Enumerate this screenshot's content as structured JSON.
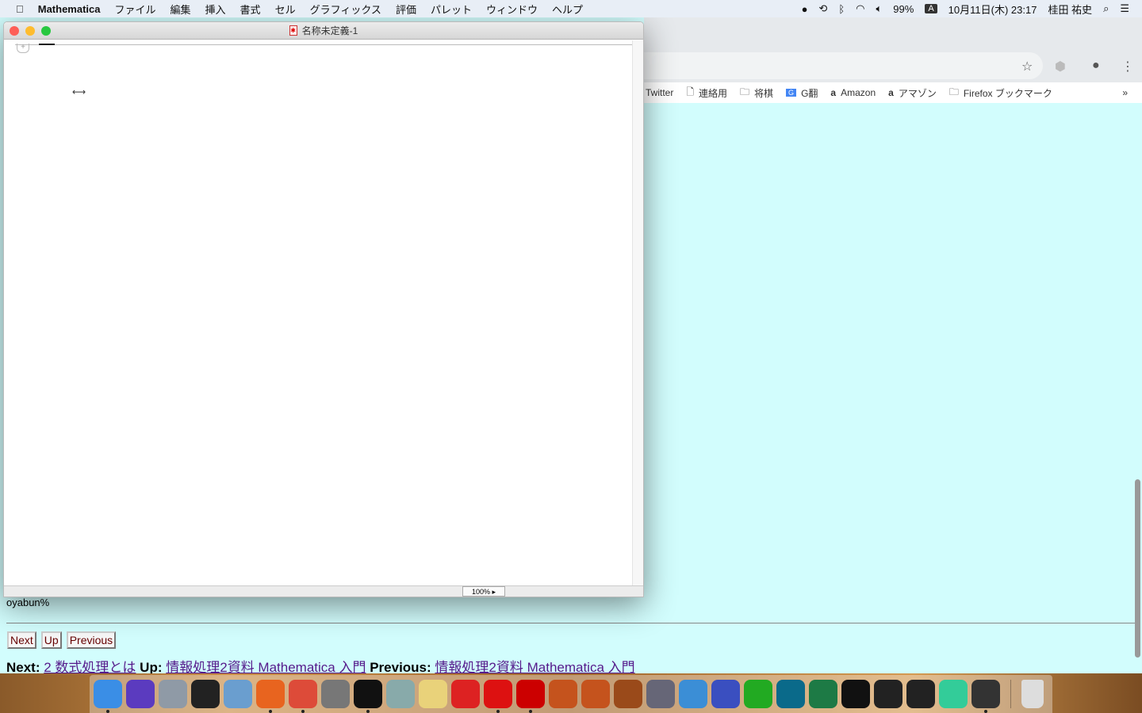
{
  "menubar": {
    "app": "Mathematica",
    "items": [
      "ファイル",
      "編集",
      "挿入",
      "書式",
      "セル",
      "グラフィックス",
      "評価",
      "パレット",
      "ウィンドウ",
      "ヘルプ"
    ],
    "battery": "99%",
    "ime": "A",
    "datetime": "10月11日(木)  23:17",
    "user": "桂田 祐史"
  },
  "window": {
    "title": "名称未定義-1",
    "zoom": "100%",
    "colors": {
      "close": "#fe5f57",
      "minimize": "#febc2e",
      "maximize": "#28c840"
    }
  },
  "browser": {
    "bookmarks": [
      {
        "icon": "bird-icon",
        "label": "Twitter"
      },
      {
        "icon": "page-icon",
        "label": "連絡用"
      },
      {
        "icon": "folder-icon",
        "label": "将棋"
      },
      {
        "icon": "google-translate-icon",
        "label": "G翻"
      },
      {
        "icon": "amazon-icon",
        "label": "Amazon"
      },
      {
        "icon": "amazon-icon",
        "label": "アマゾン"
      },
      {
        "icon": "folder-icon",
        "label": "Firefox ブックマーク"
      }
    ],
    "more": "»"
  },
  "page": {
    "prompt": "oyabun%",
    "buttons": {
      "next": "Next",
      "up": "Up",
      "previous": "Previous"
    },
    "links": {
      "next_label": "Next:",
      "next": "2 数式処理とは",
      "up_label": "Up:",
      "up": "情報処理2資料 Mathematica 入門",
      "previous_label": "Previous:",
      "previous": "情報処理2資料 Mathematica 入門"
    },
    "link_color": "#551a8b",
    "background": "#d2fdfd"
  },
  "dock": [
    {
      "name": "finder",
      "color": "#3a8ee6",
      "run": true
    },
    {
      "name": "siri",
      "color": "#5b3bbf"
    },
    {
      "name": "launchpad",
      "color": "#8f9aa6"
    },
    {
      "name": "photo-booth",
      "color": "#222"
    },
    {
      "name": "preview",
      "color": "#6a9ecf"
    },
    {
      "name": "firefox",
      "color": "#e8641f",
      "run": true
    },
    {
      "name": "chrome",
      "color": "#dd4b39",
      "run": true
    },
    {
      "name": "system-preferences",
      "color": "#777"
    },
    {
      "name": "terminal",
      "color": "#111",
      "run": true
    },
    {
      "name": "image-capture",
      "color": "#8aa"
    },
    {
      "name": "script-editor",
      "color": "#e9d27a"
    },
    {
      "name": "acrobat",
      "color": "#d22"
    },
    {
      "name": "mathematica",
      "color": "#d11",
      "run": true
    },
    {
      "name": "wolfram",
      "color": "#c00",
      "run": true
    },
    {
      "name": "matlab",
      "color": "#c5531d"
    },
    {
      "name": "matlab-2",
      "color": "#c5531d"
    },
    {
      "name": "texshop",
      "color": "#9a4a1a"
    },
    {
      "name": "tex",
      "color": "#667"
    },
    {
      "name": "xcode",
      "color": "#3b8ed6"
    },
    {
      "name": "safari-5",
      "color": "#3a4fc0"
    },
    {
      "name": "app-s",
      "color": "#2a2"
    },
    {
      "name": "screen",
      "color": "#0a6a8a"
    },
    {
      "name": "excel",
      "color": "#1d7a45"
    },
    {
      "name": "terminal-2",
      "color": "#111"
    },
    {
      "name": "activity-monitor",
      "color": "#222"
    },
    {
      "name": "console",
      "color": "#222"
    },
    {
      "name": "atom",
      "color": "#3c9"
    },
    {
      "name": "x11",
      "color": "#333",
      "run": true
    }
  ],
  "trash": {
    "name": "trash"
  }
}
